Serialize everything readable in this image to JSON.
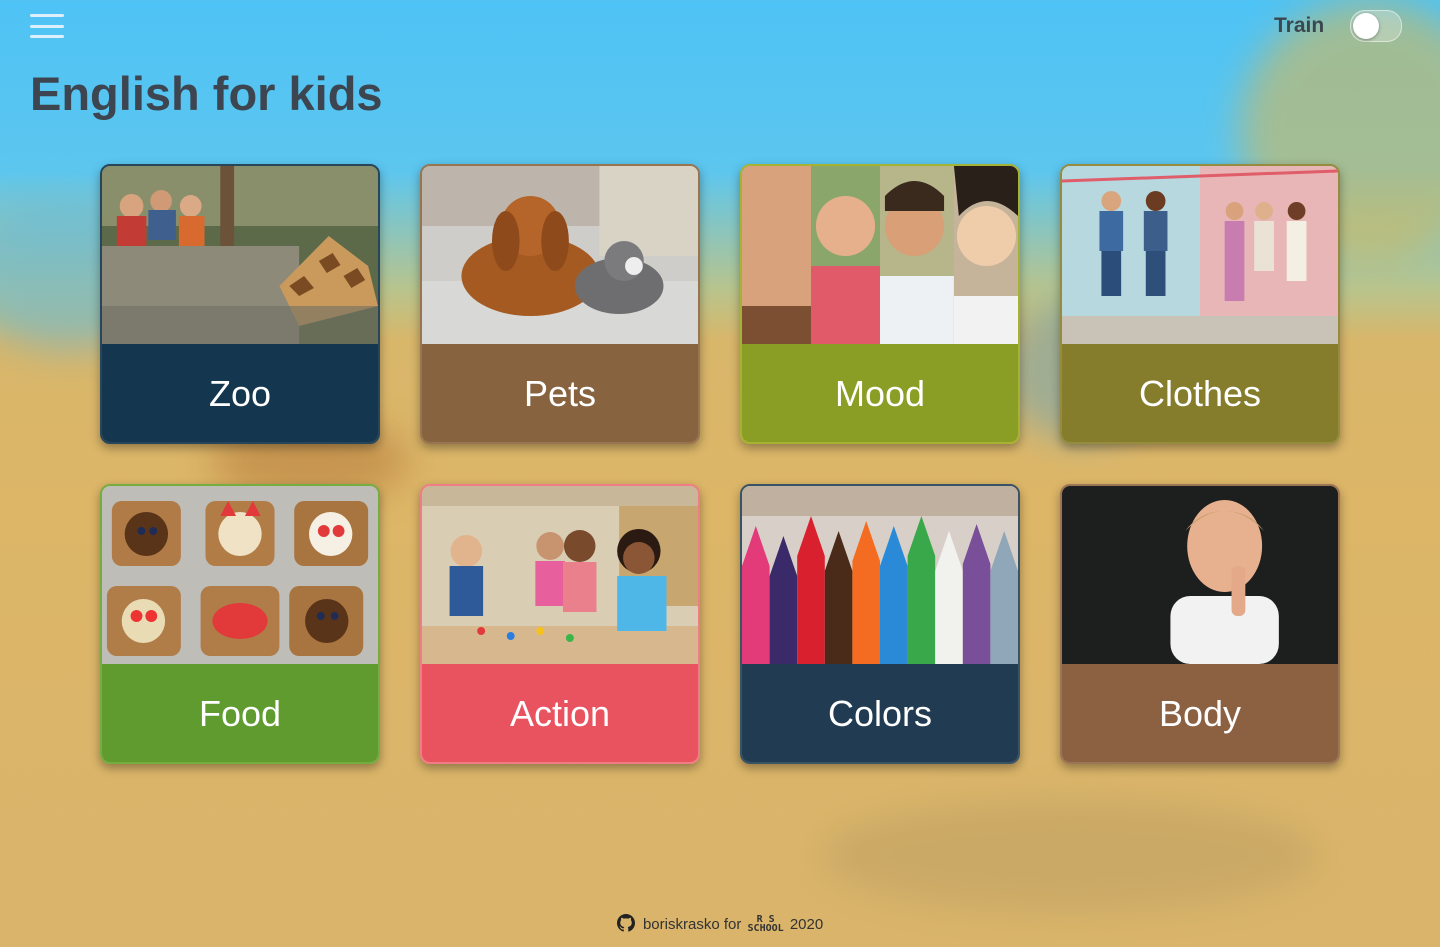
{
  "header": {
    "menu_icon": "hamburger-menu-icon",
    "title": "English for kids",
    "mode_label": "Train",
    "mode_toggle_on": false
  },
  "categories": [
    {
      "label": "Zoo",
      "color": "#14364e",
      "border": "#27465c",
      "image": "children-feeding-giraffe"
    },
    {
      "label": "Pets",
      "color": "#87633f",
      "border": "#987451",
      "image": "dog-and-cat-lying"
    },
    {
      "label": "Mood",
      "color": "#8a9e25",
      "border": "#a6b233",
      "image": "children-facial-expressions"
    },
    {
      "label": "Clothes",
      "color": "#857c2c",
      "border": "#958c40",
      "image": "kids-fashion-outfits"
    },
    {
      "label": "Food",
      "color": "#5f9b2f",
      "border": "#76ad40",
      "image": "animal-shaped-toasts"
    },
    {
      "label": "Action",
      "color": "#e9535f",
      "border": "#f07c86",
      "image": "children-playing-at-table"
    },
    {
      "label": "Colors",
      "color": "#213c52",
      "border": "#385266",
      "image": "colored-pencils"
    },
    {
      "label": "Body",
      "color": "#8b6141",
      "border": "#9c7456",
      "image": "boy-thinking"
    }
  ],
  "footer": {
    "github_icon": "github-icon",
    "author": "boriskrasko",
    "for_text": "for",
    "school_logo_top": "R S",
    "school_logo_bottom": "SCHOOL",
    "year": "2020"
  }
}
